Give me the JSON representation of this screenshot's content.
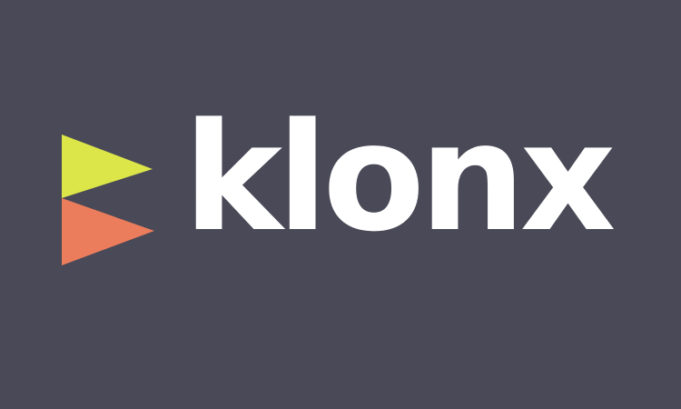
{
  "colors": {
    "background": "#4a4957",
    "wordmark": "#ffffff",
    "flag_top": "#dce649",
    "flag_bottom": "#ec7d5c"
  },
  "brand": {
    "name": "klonx",
    "mark_icon": "twin-flag-icon"
  }
}
